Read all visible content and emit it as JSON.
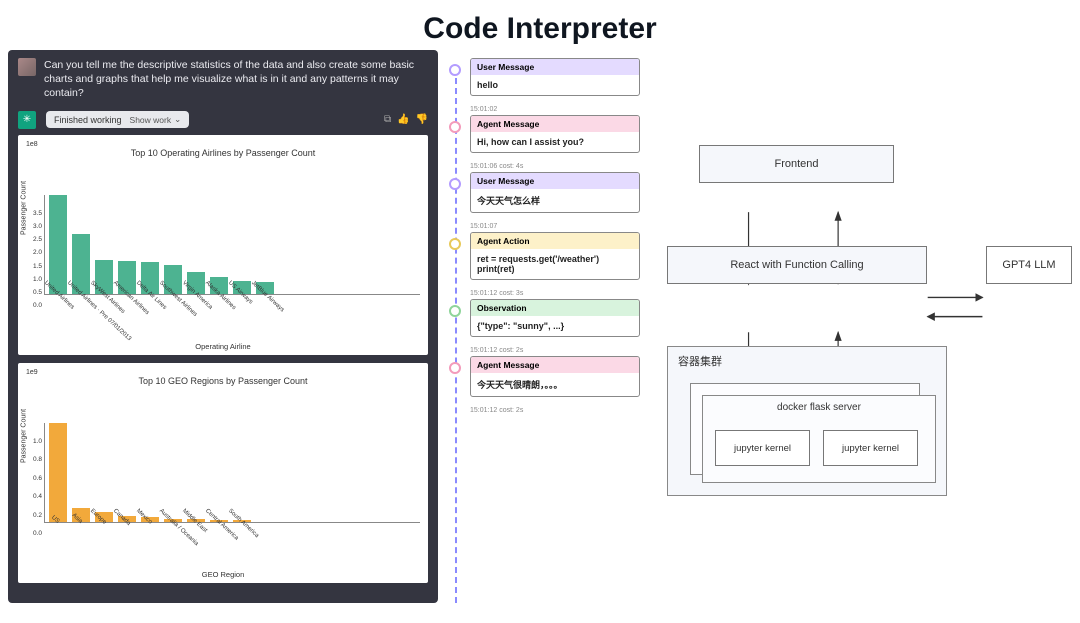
{
  "title": "Code Interpreter",
  "chat": {
    "user_prompt": "Can you tell me the descriptive statistics of the data and also create some basic charts and graphs that help me visualize what is in it and any patterns it may contain?",
    "status_pill": "Finished working",
    "show_work": "Show work"
  },
  "chart_data": [
    {
      "type": "bar",
      "title": "Top 10 Operating Airlines by Passenger Count",
      "scale_note": "1e8",
      "xlabel": "Operating Airline",
      "ylabel": "Passenger Count",
      "ylim": [
        0,
        3.5
      ],
      "yticks": [
        0.0,
        0.5,
        1.0,
        1.5,
        2.0,
        2.5,
        3.0,
        3.5
      ],
      "categories": [
        "United Airlines",
        "United Airlines · Pre 07/01/2013",
        "SkyWest Airlines",
        "American Airlines",
        "Delta Air Lines",
        "Southwest Airlines",
        "Virgin America",
        "Alaska Airlines",
        "US Airways",
        "JetBlue Airways"
      ],
      "values": [
        3.5,
        2.1,
        1.2,
        1.15,
        1.1,
        1.0,
        0.75,
        0.6,
        0.45,
        0.4
      ],
      "color": "#4db391"
    },
    {
      "type": "bar",
      "title": "Top 10 GEO Regions by Passenger Count",
      "scale_note": "1e9",
      "xlabel": "GEO Region",
      "ylabel": "Passenger Count",
      "ylim": [
        0,
        1.0
      ],
      "yticks": [
        0.0,
        0.2,
        0.4,
        0.6,
        0.8,
        1.0
      ],
      "categories": [
        "US",
        "Asia",
        "Europe",
        "Canada",
        "Mexico",
        "Australia / Oceania",
        "Middle East",
        "Central America",
        "South America"
      ],
      "values": [
        1.05,
        0.14,
        0.1,
        0.06,
        0.05,
        0.03,
        0.025,
        0.02,
        0.015
      ],
      "color": "#f2a93b"
    }
  ],
  "timeline": [
    {
      "kind": "User Message",
      "color": "purple",
      "body": "hello",
      "time": "15:01:02"
    },
    {
      "kind": "Agent Message",
      "color": "pink",
      "body": "Hi, how can I assist you?",
      "time": "15:01:06 cost: 4s"
    },
    {
      "kind": "User Message",
      "color": "purple",
      "body": "今天天气怎么样",
      "time": "15:01:07"
    },
    {
      "kind": "Agent Action",
      "color": "yellow",
      "body": "ret = requests.get('/weather')\nprint(ret)",
      "time": "15:01:12 cost: 3s"
    },
    {
      "kind": "Observation",
      "color": "green",
      "body": "{\"type\": \"sunny\", ...}",
      "time": "15:01:12 cost: 2s"
    },
    {
      "kind": "Agent Message",
      "color": "pink",
      "body": "今天天气很晴朗，。。。",
      "time": "15:01:12 cost: 2s"
    }
  ],
  "arch": {
    "frontend": "Frontend",
    "react": "React with Function Calling",
    "llm": "GPT4 LLM",
    "cluster_label": "容器集群",
    "docker_label": "docker flask server",
    "kernel1": "jupyter kernel",
    "kernel2": "jupyter kernel"
  }
}
